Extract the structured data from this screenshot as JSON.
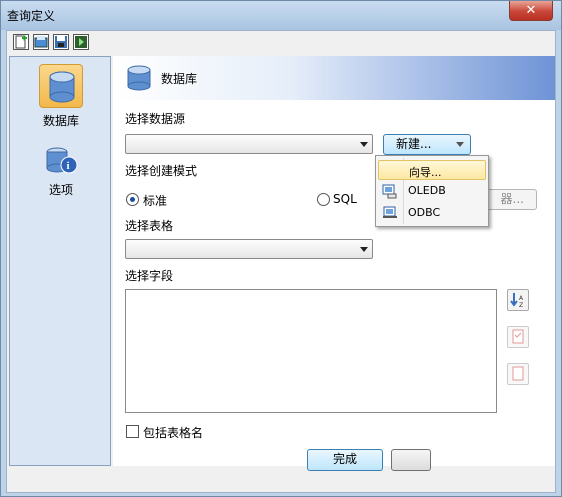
{
  "window": {
    "title": "查询定义",
    "close_glyph": "✕"
  },
  "toolbar": {
    "items": [
      "new-icon",
      "open-icon",
      "save-icon",
      "run-icon"
    ]
  },
  "nav": {
    "items": [
      {
        "label": "数据库",
        "icon": "database-icon",
        "active": true
      },
      {
        "label": "选项",
        "icon": "options-icon",
        "active": false
      }
    ]
  },
  "header": {
    "title": "数据库"
  },
  "form": {
    "datasource_label": "选择数据源",
    "datasource_value": "",
    "new_button": "新建...",
    "mode_label": "选择创建模式",
    "mode_standard": "标准",
    "mode_sql": "SQL",
    "hidden_button_tail": "器...",
    "table_label": "选择表格",
    "table_value": "",
    "fields_label": "选择字段",
    "include_table_name": "包括表格名"
  },
  "menu": {
    "items": [
      {
        "label": "向导...",
        "icon": "wizard-icon",
        "highlighted": true
      },
      {
        "label": "OLEDB",
        "icon": "oledb-icon",
        "highlighted": false
      },
      {
        "label": "ODBC",
        "icon": "odbc-icon",
        "highlighted": false
      }
    ]
  },
  "footer": {
    "finish_button": "完成"
  },
  "colors": {
    "accent": "#3c7fb1",
    "header_gradient_end": "#6e93d6",
    "close_button": "#c9473a",
    "menu_highlight": "#fde8a3"
  }
}
